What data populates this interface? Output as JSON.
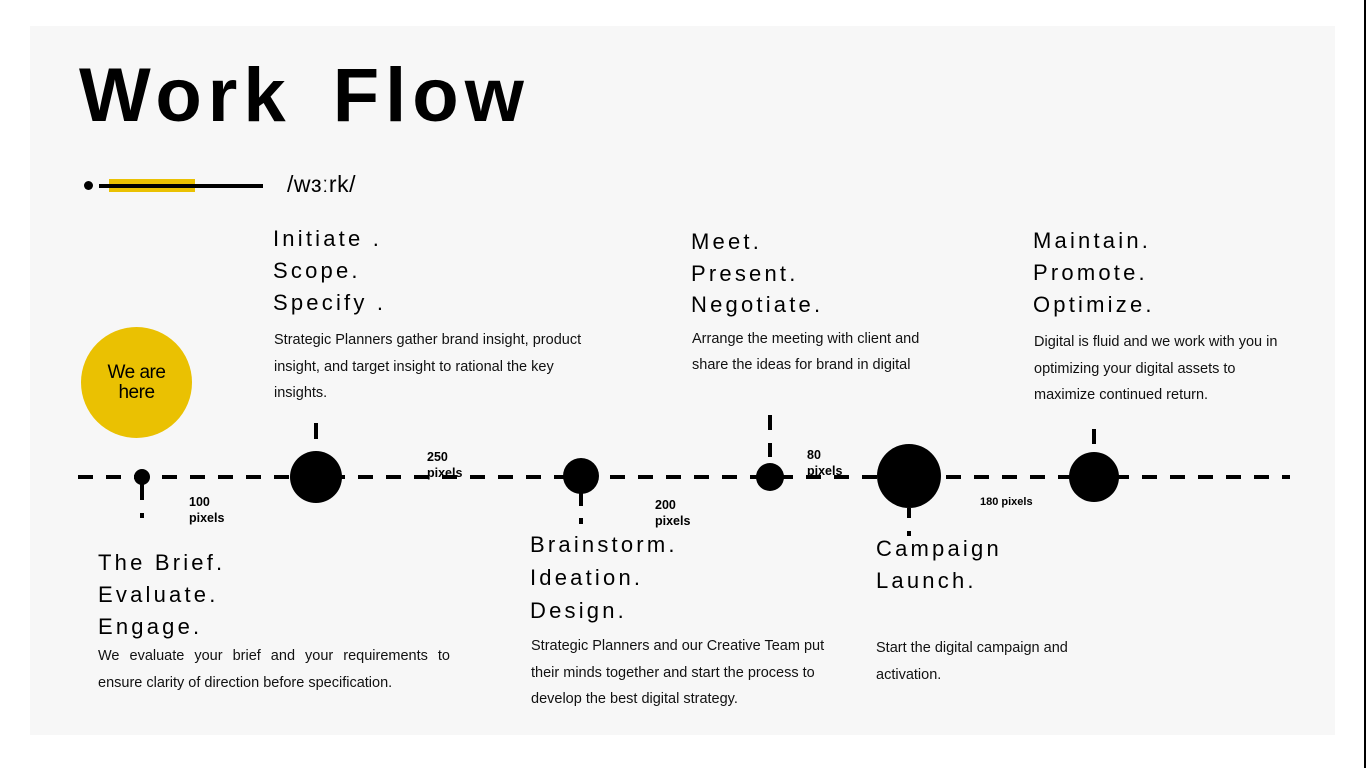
{
  "page": {
    "title": "Work Flow",
    "phonetic": "/wɜːrk/",
    "accent_color": "#eac102"
  },
  "marker": {
    "label": "We are here"
  },
  "stages": [
    {
      "headings": [
        "The Brief.",
        "Evaluate.",
        "Engage."
      ],
      "description": "We evaluate your brief and your  requirements to ensure clarity of  direction before specification.",
      "position": "below"
    },
    {
      "headings": [
        "Initiate .",
        "Scope.",
        "Specify ."
      ],
      "description": "Strategic Planners gather brand insight,  product insight, and target insight to  rational the key insights.",
      "position": "above"
    },
    {
      "headings": [
        "Brainstorm.",
        "Ideation.",
        "Design."
      ],
      "description": "Strategic Planners and our  Creative Team put their minds  together and start the process to develop the best digital strategy.",
      "position": "below"
    },
    {
      "headings": [
        "Meet.",
        "Present.",
        "Negotiate."
      ],
      "description": "Arrange the meeting with client and share  the ideas for brand in digital",
      "position": "above"
    },
    {
      "headings": [
        "Campaign",
        "Launch."
      ],
      "description": "Start the digital campaign and activation.",
      "position": "below"
    },
    {
      "headings": [
        "Maintain.",
        "Promote.",
        "Optimize."
      ],
      "description": "Digital is fluid and we work with you in optimizing your digital assets to maximize continued return.",
      "position": "above"
    }
  ],
  "distances": [
    {
      "value": 100,
      "unit": "pixels",
      "label": "100\npixels"
    },
    {
      "value": 250,
      "unit": "pixels",
      "label": "250\npixels"
    },
    {
      "value": 200,
      "unit": "pixels",
      "label": "200\npixels"
    },
    {
      "value": 80,
      "unit": "pixels",
      "label": "80\npixels"
    },
    {
      "value": 180,
      "unit": "pixels",
      "label": "180 pixels"
    }
  ]
}
